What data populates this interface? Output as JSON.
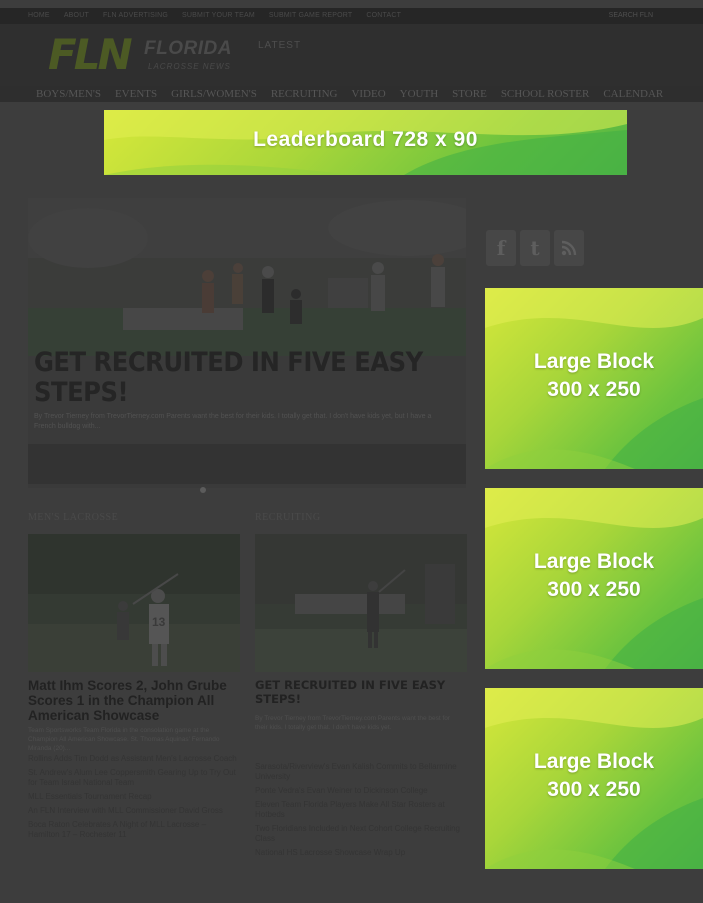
{
  "colors": {
    "ad_green_light": "#d7e83a",
    "ad_green_dark": "#55b645",
    "overlay": "#3d3d3d"
  },
  "topbar": {
    "links": [
      "Home",
      "About",
      "FLN Advertising",
      "Submit Your Team",
      "Submit Game Report",
      "Contact"
    ],
    "search_label": "Search FLN"
  },
  "header": {
    "logo_mark": "FLN",
    "logo_word": "FLORIDA",
    "logo_tagline": "LACROSSE NEWS",
    "latest_label": "LATEST"
  },
  "nav": {
    "items": [
      "Boys/Men's",
      "Events",
      "Girls/Women's",
      "Recruiting",
      "Video",
      "Youth",
      "Store",
      "School Roster",
      "Calendar"
    ]
  },
  "ads": {
    "leaderboard": "Leaderboard 728 x 90",
    "blocks": [
      {
        "line1": "Large Block",
        "line2": "300 x 250"
      },
      {
        "line1": "Large Block",
        "line2": "300 x 250"
      },
      {
        "line1": "Large Block",
        "line2": "300 x 250"
      }
    ]
  },
  "social": {
    "icons": [
      "facebook-icon",
      "twitter-icon",
      "rss-icon"
    ],
    "glyphs": [
      "f",
      "t",
      "ɣ"
    ]
  },
  "hero": {
    "title": "GET RECRUITED IN FIVE EASY STEPS!",
    "excerpt": "By Trevor Tierney from TrevorTierney.com Parents want the best for their kids. I totally get that. I don't have kids yet, but I have a French bulldog with..."
  },
  "columns": {
    "left": {
      "section_title": "Men's Lacrosse",
      "headline": "Matt Ihm Scores 2, John Grube Scores 1 in the Champion All American Showcase",
      "excerpt": "Team Sportsworks Team Florida in the consolation game at the Champion All American Showcase. St. Thomas Aquinas' Fernando Miranda (20)...",
      "links": [
        "Rollins Adds Tim Dodd as Assistant Men's Lacrosse Coach",
        "St. Andrew's Alum Lee Coppersmith Gearing Up to Try Out for Team Israel National Team",
        "MLL Essentials Tournament Recap",
        "An FLN Interview with MLL Commissioner David Gross",
        "Boca Raton Celebrates A Night of MLL Lacrosse – Hamilton 17 – Rochester 11"
      ]
    },
    "right": {
      "section_title": "Recruiting",
      "headline": "GET RECRUITED IN FIVE EASY STEPS!",
      "excerpt": "By Trevor Tierney from TrevorTierney.com Parents want the best for their kids. I totally get that. I don't have kids yet.",
      "links": [
        "Sarasota/Riverview's Evan Kalish Commits to Bellarmine University",
        "Ponte Vedra's Evan Weiner to Dickinson College",
        "Eleven Team Florida Players Make All Star Rosters at Hotbeds",
        "Two Floridians Included in Next Cohort College Recruiting Class",
        "National HS Lacrosse Showcase Wrap Up"
      ]
    }
  }
}
